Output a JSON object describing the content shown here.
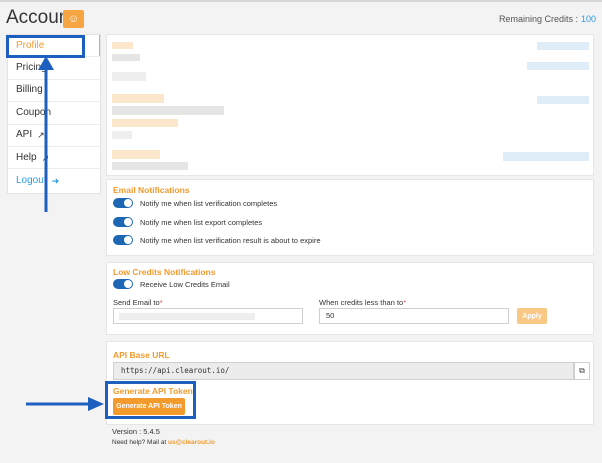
{
  "header": {
    "title": "Account",
    "credits_label": "Remaining Credits :",
    "credits_value": "100"
  },
  "sidebar": {
    "items": [
      {
        "label": "Profile"
      },
      {
        "label": "Pricing"
      },
      {
        "label": "Billing"
      },
      {
        "label": "Coupon"
      },
      {
        "label": "API"
      },
      {
        "label": "Help"
      },
      {
        "label": "Logout"
      }
    ]
  },
  "email_notifications": {
    "title": "Email Notifications",
    "options": [
      "Notify me when list verification completes",
      "Notify me when list export completes",
      "Notify me when list verification result is about to expire"
    ]
  },
  "low_credits": {
    "title": "Low Credits Notifications",
    "toggle_label": "Receive Low Credits Email",
    "send_email_label": "Send Email to",
    "threshold_label": "When credits less than to",
    "threshold_value": "50",
    "apply_label": "Apply"
  },
  "api": {
    "base_url_label": "API Base URL",
    "base_url_value": "https://api.clearout.io/",
    "token_title": "Generate API Token",
    "token_button": "Generate API Token"
  },
  "footer": {
    "version": "Version : 5.4.5",
    "help_text": "Need help? Mail at",
    "help_email": "us@clearout.io"
  },
  "colors": {
    "accent": "#f39a2c",
    "link": "#2a9be0",
    "annotation": "#1d5fbf"
  }
}
